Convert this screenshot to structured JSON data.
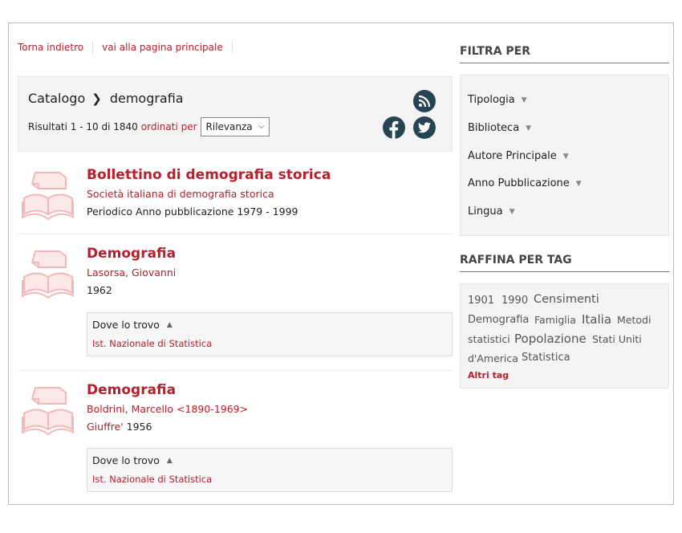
{
  "nav": {
    "back": "Torna indietro",
    "home": "vai alla pagina principale"
  },
  "search": {
    "crumb_root": "Catalogo",
    "crumb_current": "demografia",
    "results_prefix": "Risultati 1 - 10 di 1840",
    "ordered_by": "ordinati per",
    "sort_value": "Rilevanza"
  },
  "results": [
    {
      "title": "Bollettino di demografia storica",
      "author": "Società italiana di demografia storica",
      "meta": "Periodico Anno pubblicazione 1979 - 1999"
    },
    {
      "title": "Demografia",
      "author": "Lasorsa, Giovanni",
      "meta": "1962",
      "where_label": "Dove lo trovo",
      "library": "Ist. Nazionale di Statistica"
    },
    {
      "title": "Demografia",
      "author": "Boldrini, Marcello <1890-1969>",
      "publisher": "Giuffre'",
      "meta": "1956",
      "where_label": "Dove lo trovo",
      "library": "Ist. Nazionale di Statistica"
    }
  ],
  "filters": {
    "heading": "FILTRA PER",
    "items": [
      "Tipologia",
      "Biblioteca",
      "Autore Principale",
      "Anno Pubblicazione",
      "Lingua"
    ]
  },
  "tags": {
    "heading": "RAFFINA PER TAG",
    "items": [
      "1901",
      "1990",
      "Censimenti",
      "Demografia",
      "Famiglia",
      "Italia",
      "Metodi",
      "statistici",
      "Popolazione",
      "Stati Uniti",
      "d'America",
      "Statistica"
    ],
    "more": "Altri tag"
  },
  "icons": [
    "rss-icon",
    "facebook-icon",
    "twitter-icon",
    "book-icon",
    "chevron-right-icon",
    "chevron-down-icon",
    "triangle-down-icon",
    "triangle-up-icon"
  ],
  "colors": {
    "accent": "#b5202c",
    "social": "#254553"
  }
}
